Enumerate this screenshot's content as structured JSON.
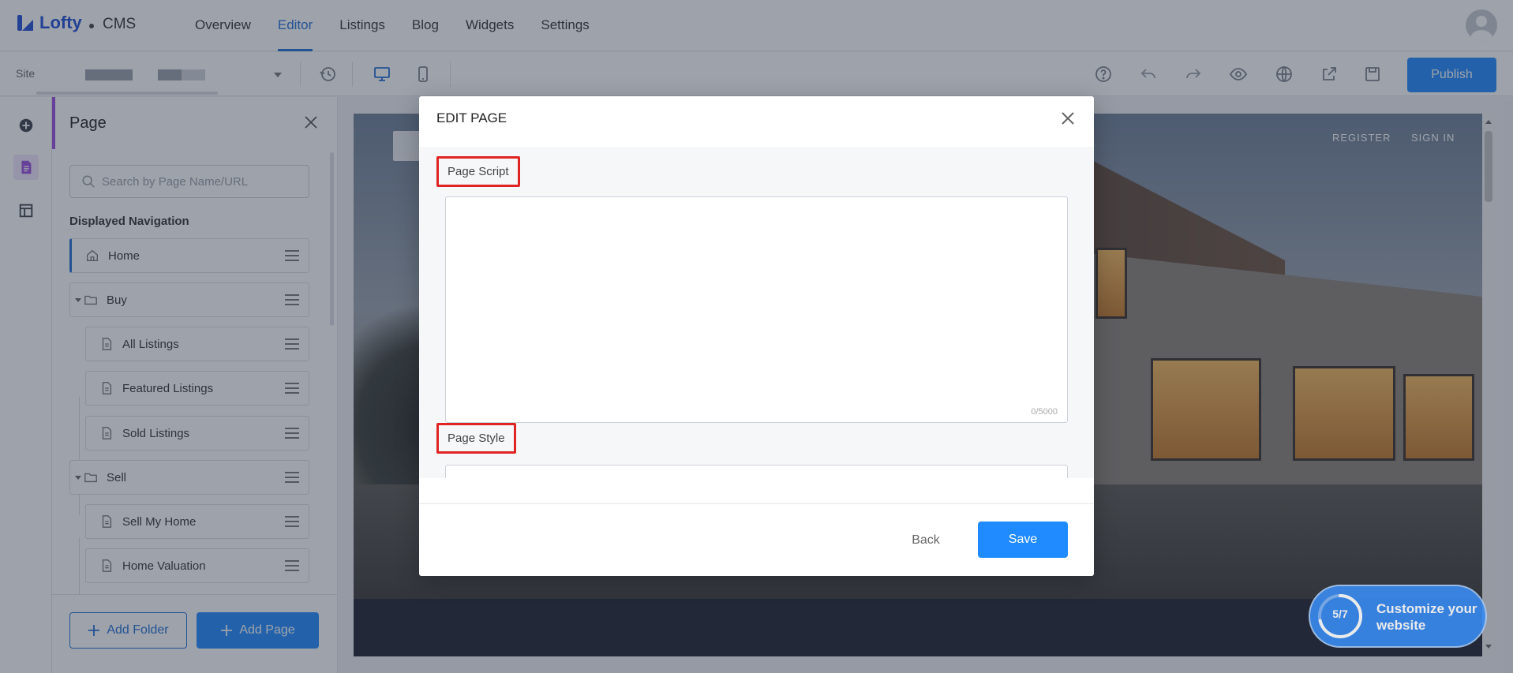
{
  "app": {
    "logo_text": "Lofty",
    "product": "CMS"
  },
  "topnav": {
    "items": [
      {
        "label": "Overview"
      },
      {
        "label": "Editor"
      },
      {
        "label": "Listings"
      },
      {
        "label": "Blog"
      },
      {
        "label": "Widgets"
      },
      {
        "label": "Settings"
      }
    ],
    "active": "Editor"
  },
  "toolbar": {
    "site_label": "Site",
    "publish_label": "Publish",
    "icons": [
      "history-icon",
      "desktop-icon",
      "mobile-icon",
      "help-icon",
      "undo-icon",
      "redo-icon",
      "preview-icon",
      "globe-icon",
      "share-icon",
      "save-draft-icon"
    ]
  },
  "panel": {
    "title": "Page",
    "search_placeholder": "Search by Page Name/URL",
    "nav_heading": "Displayed Navigation",
    "items": [
      {
        "label": "Home",
        "type": "home"
      },
      {
        "label": "Buy",
        "type": "folder"
      },
      {
        "label": "All Listings",
        "type": "page"
      },
      {
        "label": "Featured Listings",
        "type": "page"
      },
      {
        "label": "Sold Listings",
        "type": "page"
      },
      {
        "label": "Sell",
        "type": "folder"
      },
      {
        "label": "Sell My Home",
        "type": "page"
      },
      {
        "label": "Home Valuation",
        "type": "page"
      }
    ],
    "add_folder_label": "Add Folder",
    "add_page_label": "Add Page"
  },
  "canvas": {
    "register_label": "REGISTER",
    "signin_label": "SIGN IN"
  },
  "modal": {
    "title": "EDIT PAGE",
    "page_script_label": "Page Script",
    "page_script_counter": "0/5000",
    "page_style_label": "Page Style",
    "back_label": "Back",
    "save_label": "Save"
  },
  "customize": {
    "progress": "5/7",
    "progress_fraction": 0.714,
    "label": "Customize your website"
  },
  "colors": {
    "accent": "#1f8bff",
    "highlight": "#e02424",
    "brand": "#1f4fd8"
  }
}
